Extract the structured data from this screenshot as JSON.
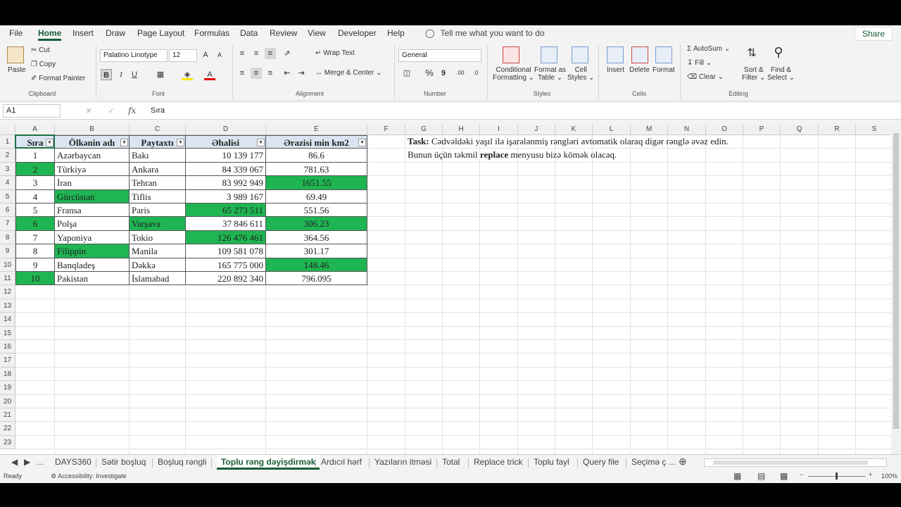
{
  "ribbon_tabs": [
    "File",
    "Home",
    "Insert",
    "Draw",
    "Page Layout",
    "Formulas",
    "Data",
    "Review",
    "View",
    "Developer",
    "Help"
  ],
  "tell_me": "Tell me what you want to do",
  "share": "Share",
  "clipboard": {
    "paste": "Paste",
    "cut": "Cut",
    "copy": "Copy",
    "format_painter": "Format Painter",
    "label": "Clipboard"
  },
  "font": {
    "name": "Palatino Linotype",
    "size": "12",
    "bold": "B",
    "italic": "I",
    "underline": "U",
    "label": "Font"
  },
  "alignment": {
    "wrap": "Wrap Text",
    "merge": "Merge & Center",
    "label": "Alignment"
  },
  "number": {
    "format": "General",
    "percent": "%",
    "comma": "9",
    "label": "Number"
  },
  "styles": {
    "cond": "Conditional",
    "cond2": "Formatting",
    "fmt_table": "Format as",
    "fmt_table2": "Table",
    "cell_styles": "Cell",
    "cell_styles2": "Styles",
    "label": "Styles"
  },
  "cells": {
    "insert": "Insert",
    "delete": "Delete",
    "format": "Format",
    "label": "Cells"
  },
  "editing": {
    "autosum": "AutoSum",
    "fill": "Fill",
    "clear": "Clear",
    "sort": "Sort &",
    "sort2": "Filter",
    "find": "Find &",
    "find2": "Select",
    "label": "Editing"
  },
  "formula_bar": {
    "name_box": "A1",
    "fx": "fx",
    "content": "Sıra"
  },
  "columns": [
    "A",
    "B",
    "C",
    "D",
    "E",
    "F",
    "G",
    "H",
    "I",
    "J",
    "K",
    "L",
    "M",
    "N",
    "O",
    "P",
    "Q",
    "R",
    "S"
  ],
  "rows": [
    "1",
    "2",
    "3",
    "4",
    "5",
    "6",
    "7",
    "8",
    "9",
    "10",
    "11",
    "12",
    "13",
    "14",
    "15",
    "16",
    "17",
    "18",
    "19",
    "20",
    "21",
    "22",
    "23"
  ],
  "table": {
    "headers": [
      "Sıra",
      "Ölkənin adı",
      "Paytaxtı",
      "Əhalisi",
      "Ərazisi min km2"
    ],
    "rows": [
      [
        "1",
        "Azərbaycan",
        "Bakı",
        "10 139 177",
        "86.6"
      ],
      [
        "2",
        "Türkiyə",
        "Ankara",
        "84 339 067",
        "781.63"
      ],
      [
        "3",
        "İran",
        "Tehran",
        "83 992 949",
        "1651.55"
      ],
      [
        "4",
        "Gürcüstan",
        "Tiflis",
        "3 989 167",
        "69.49"
      ],
      [
        "5",
        "Fransa",
        "Paris",
        "65 273 511",
        "551.56"
      ],
      [
        "6",
        "Polşa",
        "Varşava",
        "37 846 611",
        "306.23"
      ],
      [
        "7",
        "Yaponiya",
        "Tokio",
        "126 476 461",
        "364.56"
      ],
      [
        "8",
        "Filippin",
        "Manila",
        "109 581 078",
        "301.17"
      ],
      [
        "9",
        "Banqladeş",
        "Dəkkə",
        "165 775 000",
        "148.46"
      ],
      [
        "10",
        "Pakistan",
        "İslamabad",
        "220 892 340",
        "796.095"
      ]
    ],
    "green_color": "#1fb552"
  },
  "task": {
    "bold": "Task:",
    "line1": " Cədvəldəki yaşıl ilə işarələnmiş rəngləri avtomatik olaraq digər rənglə əvəz edin.",
    "line2_a": "Bunun üçün təkmil ",
    "line2_b": "replace",
    "line2_c": " menyusu bizə kömək olacaq."
  },
  "sheet_tabs": [
    "DAYS360",
    "Sətir boşluq",
    "Boşluq rəngli",
    "Toplu rəng dəyişdirmək",
    "Ardıcıl hərf",
    "Yazıların itməsi",
    "Total",
    "Replace trick",
    "Toplu fayl",
    "Query file",
    "Seçimə ç ..."
  ],
  "status": {
    "ready": "Ready",
    "accessibility": "Accessibility: Investigate",
    "zoom": "100%"
  }
}
